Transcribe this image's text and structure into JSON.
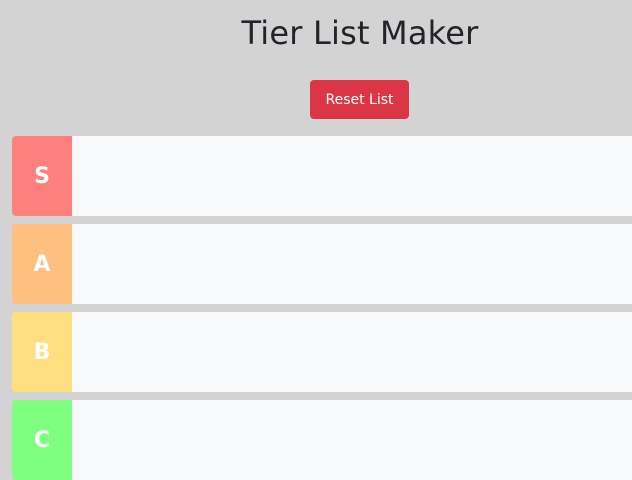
{
  "header": {
    "title": "Tier List Maker",
    "reset_label": "Reset List"
  },
  "tiers": [
    {
      "label": "S",
      "color": "#ff7f7f"
    },
    {
      "label": "A",
      "color": "#ffbf7f"
    },
    {
      "label": "B",
      "color": "#ffdf7f"
    },
    {
      "label": "C",
      "color": "#7fff7f"
    }
  ]
}
